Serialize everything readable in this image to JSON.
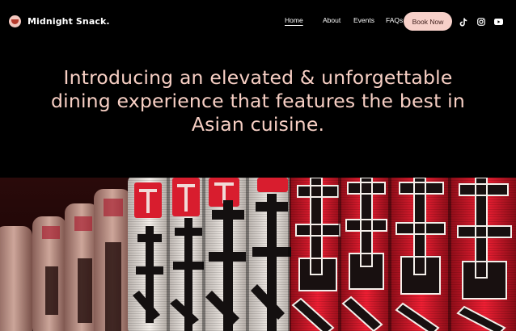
{
  "header": {
    "brand": "Midnight Snack.",
    "nav": [
      {
        "label": "Home",
        "active": true
      },
      {
        "label": "About"
      },
      {
        "label": "Events"
      },
      {
        "label": "FAQs"
      }
    ],
    "cta_label": "Book Now",
    "social_icons": [
      "tiktok-icon",
      "instagram-icon",
      "youtube-icon"
    ]
  },
  "hero": {
    "headline": "Introducing an elevated & unforgettable dining experience that features the best in Asian cuisine."
  },
  "banner": {
    "description_icon": "paper-lanterns-image"
  },
  "colors": {
    "background": "#000000",
    "headline": "#f7cfc4",
    "cta_background": "#f7d0c9",
    "lantern_red": "#e0182b"
  }
}
